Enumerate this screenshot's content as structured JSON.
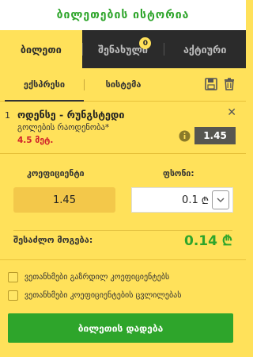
{
  "header": {
    "history_label": "ბილეთების ისტორია"
  },
  "tabs": [
    {
      "label": "ბილეთი",
      "active": true
    },
    {
      "label": "შენახული",
      "badge": "0"
    },
    {
      "label": "აქტიური"
    }
  ],
  "subtabs": [
    {
      "label": "ექსპრესი",
      "active": true
    },
    {
      "label": "სისტემა"
    }
  ],
  "toolbar": {
    "icons": [
      "save-icon",
      "trash-icon"
    ]
  },
  "bet": {
    "number": "1",
    "title": "ოდენსე - რუნგსტედი",
    "market": "გოლების რაოდენობა*",
    "selection": "4.5 მეტ.",
    "odd": "1.45"
  },
  "stake_form": {
    "coef_label": "კოეფიციენტი",
    "coef_value": "1.45",
    "stake_label": "ფსონი:",
    "stake_value": "0.1",
    "currency": "₾"
  },
  "winnings": {
    "label": "შესაძლო მოგება:",
    "value": "0.14 ₾"
  },
  "options": [
    {
      "label": "ვეთანხმები გაზრდილ კოეფიციენტებს",
      "checked": false
    },
    {
      "label": "ვეთანხმები კოეფიციენტების ცვლილებას",
      "checked": false
    }
  ],
  "place_button": {
    "label": "ბილეთის დადება"
  },
  "colors": {
    "accent_green": "#2ea52b",
    "background_yellow": "#ffe15a",
    "dark": "#2b2b2b",
    "red": "#d0202b"
  }
}
